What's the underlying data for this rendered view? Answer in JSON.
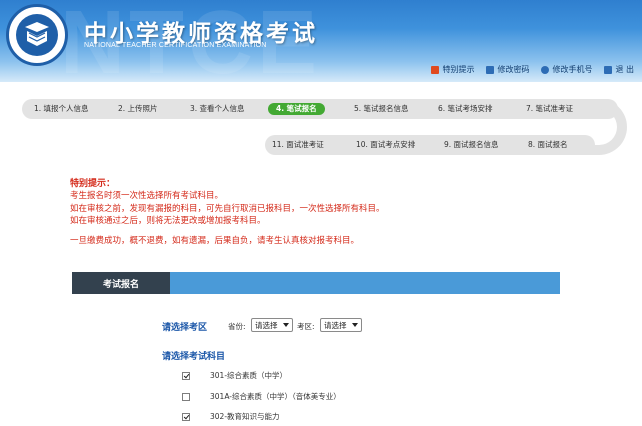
{
  "header": {
    "watermark": "NTCE",
    "title": "中小学教师资格考试",
    "subtitle": "NATIONAL TEACHER CERTIFICATION EXAMINATION",
    "links": [
      {
        "label": "特别提示",
        "icon": "notice-icon"
      },
      {
        "label": "修改密码",
        "icon": "password-icon"
      },
      {
        "label": "修改手机号",
        "icon": "phone-icon"
      },
      {
        "label": "退 出",
        "icon": "logout-icon"
      }
    ]
  },
  "steps": [
    {
      "label": "1. 填报个人信息",
      "active": false
    },
    {
      "label": "2. 上传照片",
      "active": false
    },
    {
      "label": "3. 查看个人信息",
      "active": false
    },
    {
      "label": "4. 笔试报名",
      "active": true
    },
    {
      "label": "5. 笔试报名信息",
      "active": false
    },
    {
      "label": "6. 笔试考场安排",
      "active": false
    },
    {
      "label": "7. 笔试准考证",
      "active": false
    },
    {
      "label": "8. 面试报名",
      "active": false
    },
    {
      "label": "9. 面试报名信息",
      "active": false
    },
    {
      "label": "10. 面试考点安排",
      "active": false
    },
    {
      "label": "11. 面试准考证",
      "active": false
    }
  ],
  "notice": {
    "title": "特别提示：",
    "lines": [
      "考生报名时须一次性选择所有考试科目。",
      "如在审核之前，发现有漏报的科目，可先自行取消已报科目，一次性选择所有科目。",
      "如在审核通过之后，则将无法更改或增加报考科目。"
    ],
    "final": "一旦缴费成功，概不退费，如有遗漏，后果自负，请考生认真核对报考科目。"
  },
  "panel": {
    "tab_label": "考试报名",
    "region_label": "请选择考区",
    "province_label": "省份:",
    "province_value": "请选择",
    "district_label": "考区:",
    "district_value": "请选择",
    "subjects_label": "请选择考试科目",
    "subjects": [
      {
        "label": "301-综合素质（中学）",
        "checked": true
      },
      {
        "label": "301A-综合素质（中学）（音体美专业）",
        "checked": false
      },
      {
        "label": "302-教育知识与能力",
        "checked": true
      }
    ]
  },
  "colors": {
    "accent_blue": "#4a9ad8",
    "active_step": "#43a933",
    "notice_red": "#d42a1a",
    "section_blue": "#1a56a8"
  }
}
